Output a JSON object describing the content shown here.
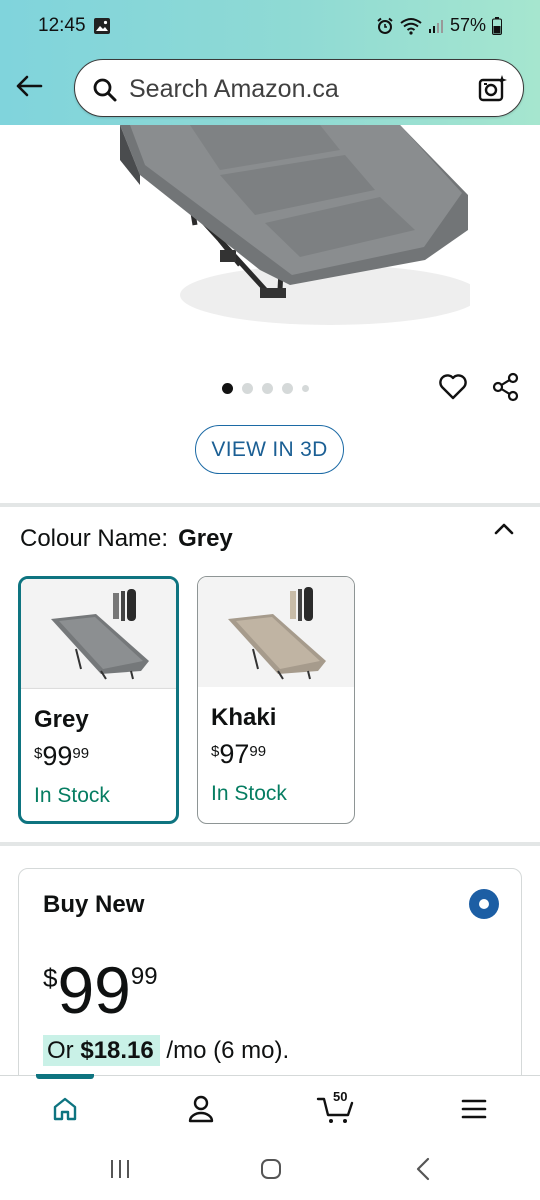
{
  "status_bar": {
    "time": "12:45",
    "battery": "57%"
  },
  "search": {
    "placeholder": "Search Amazon.ca"
  },
  "product": {
    "view_3d_label": "VIEW IN 3D",
    "carousel_total": 5,
    "carousel_active": 1
  },
  "colour": {
    "label": "Colour Name:",
    "selected": "Grey",
    "options": [
      {
        "name": "Grey",
        "currency": "$",
        "whole": "99",
        "fraction": "99",
        "stock": "In Stock"
      },
      {
        "name": "Khaki",
        "currency": "$",
        "whole": "97",
        "fraction": "99",
        "stock": "In Stock"
      }
    ]
  },
  "buy_box": {
    "title": "Buy New",
    "currency": "$",
    "whole": "99",
    "fraction": "99",
    "monthly_prefix": "Or",
    "monthly_amount": "$18.16",
    "monthly_suffix": "/mo (6 mo)."
  },
  "bottom_nav": {
    "cart_count": "50"
  },
  "colors": {
    "accent_teal": "#0e7480",
    "link_blue": "#1b5f94",
    "in_stock_green": "#067d62",
    "radio_blue": "#1c5ea4"
  }
}
